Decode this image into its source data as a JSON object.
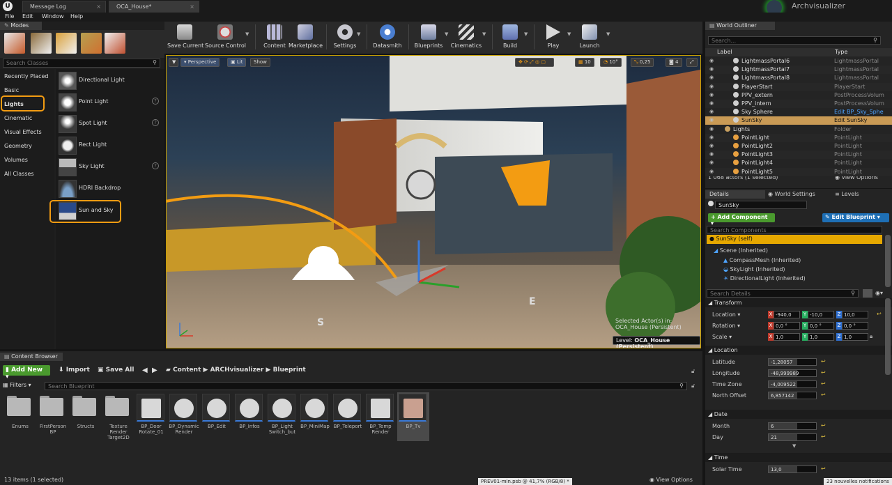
{
  "titlebar": {
    "tabs": [
      {
        "label": "Message Log"
      },
      {
        "label": "OCA_House*"
      }
    ],
    "app_name": "Archvisualizer",
    "window_controls": [
      "minimize-icon",
      "maximize-icon",
      "close-icon"
    ],
    "glyphs": {
      "minimize": "—",
      "maximize": "☐",
      "close": "✕",
      "tab_close": "×"
    }
  },
  "menubar": [
    "File",
    "Edit",
    "Window",
    "Help"
  ],
  "modes": {
    "tab_label": "Modes",
    "search_placeholder": "Search Classes",
    "categories": [
      "Recently Placed",
      "Basic",
      "Lights",
      "Cinematic",
      "Visual Effects",
      "Geometry",
      "Volumes",
      "All Classes"
    ],
    "selected_category": "Lights",
    "items": [
      {
        "label": "Directional Light",
        "icon": "directional-light-icon",
        "info": false
      },
      {
        "label": "Point Light",
        "icon": "point-light-icon",
        "info": true
      },
      {
        "label": "Spot Light",
        "icon": "spot-light-icon",
        "info": true
      },
      {
        "label": "Rect Light",
        "icon": "rect-light-icon",
        "info": false
      },
      {
        "label": "Sky Light",
        "icon": "sky-light-icon",
        "info": true
      },
      {
        "label": "HDRI Backdrop",
        "icon": "hdri-backdrop-icon",
        "info": false
      },
      {
        "label": "Sun and Sky",
        "icon": "sun-and-sky-icon",
        "info": false
      }
    ],
    "info_glyph": "?"
  },
  "toolbar": {
    "tools": [
      {
        "label": "Save Current",
        "icon": "save-icon",
        "dropdown": false
      },
      {
        "label": "Source Control",
        "icon": "source-control-icon",
        "dropdown": true
      },
      {
        "label": "Content",
        "icon": "content-icon",
        "dropdown": false
      },
      {
        "label": "Marketplace",
        "icon": "marketplace-icon",
        "dropdown": false
      },
      {
        "label": "Settings",
        "icon": "settings-icon",
        "dropdown": true
      },
      {
        "label": "Datasmith",
        "icon": "datasmith-icon",
        "dropdown": false
      },
      {
        "label": "Blueprints",
        "icon": "blueprints-icon",
        "dropdown": true
      },
      {
        "label": "Cinematics",
        "icon": "cinematics-icon",
        "dropdown": true
      },
      {
        "label": "Build",
        "icon": "build-icon",
        "dropdown": true
      },
      {
        "label": "Play",
        "icon": "play-icon",
        "dropdown": true
      },
      {
        "label": "Launch",
        "icon": "launch-icon",
        "dropdown": true
      }
    ],
    "dropdown_glyph": "▼"
  },
  "viewport": {
    "menu_glyph": "▼",
    "perspective": "Perspective",
    "lit": "Lit",
    "show": "Show",
    "grid_snap": "10",
    "rotate_snap": "10°",
    "scale_snap": "0,25",
    "camera_speed": "4",
    "selected_actors_line1": "Selected Actor(s) in:",
    "selected_actors_line2": "OCA_House (Persistent)",
    "level_label": "Level:",
    "level_name": "OCA_House (Persistent)",
    "compass_letters": [
      "E",
      "S"
    ]
  },
  "outliner": {
    "tab_label": "World Outliner",
    "search_placeholder": "Search...",
    "col_label": "Label",
    "col_type": "Type",
    "rows": [
      {
        "label": "LightmassPortal6",
        "type": "LightmassPortal"
      },
      {
        "label": "LightmassPortal7",
        "type": "LightmassPortal"
      },
      {
        "label": "LightmassPortal8",
        "type": "LightmassPortal"
      },
      {
        "label": "PlayerStart",
        "type": "PlayerStart"
      },
      {
        "label": "PPV_extern",
        "type": "PostProcessVolum"
      },
      {
        "label": "PPV_intern",
        "type": "PostProcessVolum"
      },
      {
        "label": "Sky Sphere",
        "type": "Edit BP_Sky_Sphe"
      },
      {
        "label": "SunSky",
        "type": "Edit SunSky"
      },
      {
        "label": "Lights",
        "type": "Folder"
      },
      {
        "label": "PointLight",
        "type": "PointLight"
      },
      {
        "label": "PointLight2",
        "type": "PointLight"
      },
      {
        "label": "PointLight3",
        "type": "PointLight"
      },
      {
        "label": "PointLight4",
        "type": "PointLight"
      },
      {
        "label": "PointLight5",
        "type": "PointLight"
      }
    ],
    "status": "1 068 actors (1 selected)",
    "view_options": "View Options"
  },
  "details": {
    "tabs": [
      "Details",
      "World Settings",
      "Levels"
    ],
    "object_name": "SunSky",
    "add_component": "+ Add Component",
    "edit_blueprint": "Edit Blueprint",
    "search_components": "Search Components",
    "components": [
      {
        "label": "SunSky (self)"
      },
      {
        "label": "Scene (Inherited)"
      },
      {
        "label": "CompassMesh (Inherited)"
      },
      {
        "label": "SkyLight (Inherited)"
      },
      {
        "label": "DirectionalLight (Inherited)"
      }
    ],
    "search_details": "Search Details",
    "sections": {
      "transform": "Transform",
      "location": "Location",
      "date": "Date",
      "time": "Time"
    },
    "transform": {
      "location": {
        "label": "Location",
        "x": "-940,0",
        "y": "-10,0",
        "z": "10,0"
      },
      "rotation": {
        "label": "Rotation",
        "x": "0,0 °",
        "y": "0,0 °",
        "z": "0,0 °"
      },
      "scale": {
        "label": "Scale",
        "x": "1,0",
        "y": "1,0",
        "z": "1,0"
      }
    },
    "location_props": [
      {
        "label": "Latitude",
        "value": "-1,28057"
      },
      {
        "label": "Longitude",
        "value": "-48,999989"
      },
      {
        "label": "Time Zone",
        "value": "-4,009522"
      },
      {
        "label": "North Offset",
        "value": "6,857142"
      }
    ],
    "date_props": [
      {
        "label": "Month",
        "value": "6"
      },
      {
        "label": "Day",
        "value": "21"
      }
    ],
    "time_props": [
      {
        "label": "Solar Time",
        "value": "13,0"
      }
    ],
    "axis_letters": [
      "X",
      "Y",
      "Z"
    ],
    "reset_glyph": "↩",
    "expand_glyph": "▼"
  },
  "content_browser": {
    "tab_label": "Content Browser",
    "add_new": "Add New",
    "import": "Import",
    "save_all": "Save All",
    "breadcrumb": [
      "Content",
      "ARCHvisualizer",
      "Blueprint"
    ],
    "filters": "Filters",
    "search_placeholder": "Search Blueprint",
    "items": [
      {
        "label": "Enums",
        "kind": "folder"
      },
      {
        "label": "FirstPerson BP",
        "kind": "folder"
      },
      {
        "label": "Structs",
        "kind": "folder"
      },
      {
        "label": "Texture Render Target2D",
        "kind": "folder"
      },
      {
        "label": "BP_Door Rotate_01",
        "kind": "asset"
      },
      {
        "label": "BP_Dynamic Render",
        "kind": "asset"
      },
      {
        "label": "BP_Edit",
        "kind": "asset"
      },
      {
        "label": "BP_Infos",
        "kind": "asset"
      },
      {
        "label": "BP_Light Switch_but",
        "kind": "asset"
      },
      {
        "label": "BP_MiniMap",
        "kind": "asset"
      },
      {
        "label": "BP_Teleport",
        "kind": "asset"
      },
      {
        "label": "BP_Temp Render",
        "kind": "asset"
      },
      {
        "label": "BP_Tv",
        "kind": "asset",
        "selected": true
      }
    ],
    "status": "13 items (1 selected)",
    "view_options": "View Options"
  },
  "statusbar": {
    "file": "PREV01-min.psb @ 41,7% (RGB/8) *",
    "notifications": "23 nouvelles notifications"
  },
  "colors": {
    "accent_orange": "#f39c12",
    "selection_gold": "#c8a000",
    "link_blue": "#4ea3ff",
    "add_green": "#4a9a2e",
    "edit_blue": "#1e6fb5"
  }
}
